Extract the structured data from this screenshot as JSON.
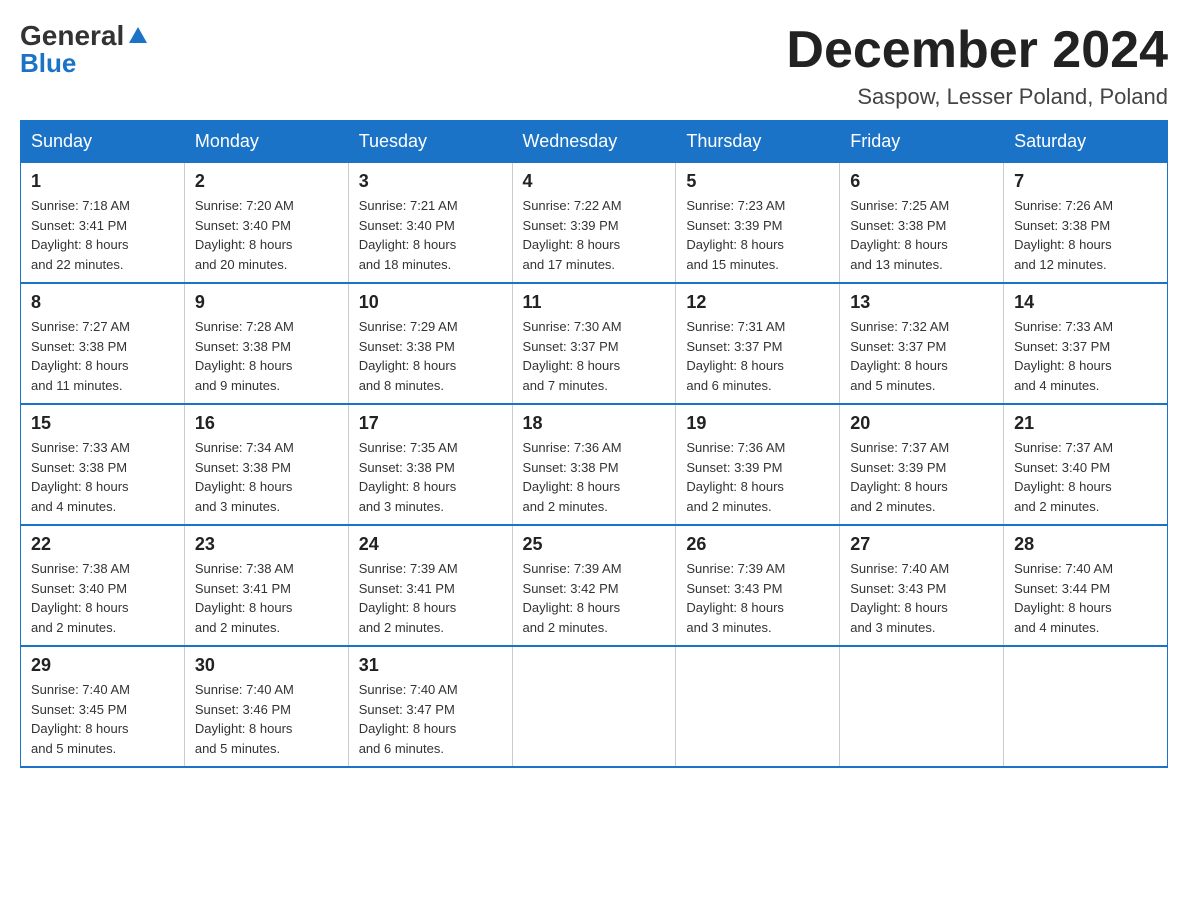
{
  "logo": {
    "general": "General",
    "blue": "Blue"
  },
  "title": "December 2024",
  "location": "Saspow, Lesser Poland, Poland",
  "days_of_week": [
    "Sunday",
    "Monday",
    "Tuesday",
    "Wednesday",
    "Thursday",
    "Friday",
    "Saturday"
  ],
  "weeks": [
    [
      {
        "day": "1",
        "sunrise": "7:18 AM",
        "sunset": "3:41 PM",
        "daylight": "8 hours and 22 minutes."
      },
      {
        "day": "2",
        "sunrise": "7:20 AM",
        "sunset": "3:40 PM",
        "daylight": "8 hours and 20 minutes."
      },
      {
        "day": "3",
        "sunrise": "7:21 AM",
        "sunset": "3:40 PM",
        "daylight": "8 hours and 18 minutes."
      },
      {
        "day": "4",
        "sunrise": "7:22 AM",
        "sunset": "3:39 PM",
        "daylight": "8 hours and 17 minutes."
      },
      {
        "day": "5",
        "sunrise": "7:23 AM",
        "sunset": "3:39 PM",
        "daylight": "8 hours and 15 minutes."
      },
      {
        "day": "6",
        "sunrise": "7:25 AM",
        "sunset": "3:38 PM",
        "daylight": "8 hours and 13 minutes."
      },
      {
        "day": "7",
        "sunrise": "7:26 AM",
        "sunset": "3:38 PM",
        "daylight": "8 hours and 12 minutes."
      }
    ],
    [
      {
        "day": "8",
        "sunrise": "7:27 AM",
        "sunset": "3:38 PM",
        "daylight": "8 hours and 11 minutes."
      },
      {
        "day": "9",
        "sunrise": "7:28 AM",
        "sunset": "3:38 PM",
        "daylight": "8 hours and 9 minutes."
      },
      {
        "day": "10",
        "sunrise": "7:29 AM",
        "sunset": "3:38 PM",
        "daylight": "8 hours and 8 minutes."
      },
      {
        "day": "11",
        "sunrise": "7:30 AM",
        "sunset": "3:37 PM",
        "daylight": "8 hours and 7 minutes."
      },
      {
        "day": "12",
        "sunrise": "7:31 AM",
        "sunset": "3:37 PM",
        "daylight": "8 hours and 6 minutes."
      },
      {
        "day": "13",
        "sunrise": "7:32 AM",
        "sunset": "3:37 PM",
        "daylight": "8 hours and 5 minutes."
      },
      {
        "day": "14",
        "sunrise": "7:33 AM",
        "sunset": "3:37 PM",
        "daylight": "8 hours and 4 minutes."
      }
    ],
    [
      {
        "day": "15",
        "sunrise": "7:33 AM",
        "sunset": "3:38 PM",
        "daylight": "8 hours and 4 minutes."
      },
      {
        "day": "16",
        "sunrise": "7:34 AM",
        "sunset": "3:38 PM",
        "daylight": "8 hours and 3 minutes."
      },
      {
        "day": "17",
        "sunrise": "7:35 AM",
        "sunset": "3:38 PM",
        "daylight": "8 hours and 3 minutes."
      },
      {
        "day": "18",
        "sunrise": "7:36 AM",
        "sunset": "3:38 PM",
        "daylight": "8 hours and 2 minutes."
      },
      {
        "day": "19",
        "sunrise": "7:36 AM",
        "sunset": "3:39 PM",
        "daylight": "8 hours and 2 minutes."
      },
      {
        "day": "20",
        "sunrise": "7:37 AM",
        "sunset": "3:39 PM",
        "daylight": "8 hours and 2 minutes."
      },
      {
        "day": "21",
        "sunrise": "7:37 AM",
        "sunset": "3:40 PM",
        "daylight": "8 hours and 2 minutes."
      }
    ],
    [
      {
        "day": "22",
        "sunrise": "7:38 AM",
        "sunset": "3:40 PM",
        "daylight": "8 hours and 2 minutes."
      },
      {
        "day": "23",
        "sunrise": "7:38 AM",
        "sunset": "3:41 PM",
        "daylight": "8 hours and 2 minutes."
      },
      {
        "day": "24",
        "sunrise": "7:39 AM",
        "sunset": "3:41 PM",
        "daylight": "8 hours and 2 minutes."
      },
      {
        "day": "25",
        "sunrise": "7:39 AM",
        "sunset": "3:42 PM",
        "daylight": "8 hours and 2 minutes."
      },
      {
        "day": "26",
        "sunrise": "7:39 AM",
        "sunset": "3:43 PM",
        "daylight": "8 hours and 3 minutes."
      },
      {
        "day": "27",
        "sunrise": "7:40 AM",
        "sunset": "3:43 PM",
        "daylight": "8 hours and 3 minutes."
      },
      {
        "day": "28",
        "sunrise": "7:40 AM",
        "sunset": "3:44 PM",
        "daylight": "8 hours and 4 minutes."
      }
    ],
    [
      {
        "day": "29",
        "sunrise": "7:40 AM",
        "sunset": "3:45 PM",
        "daylight": "8 hours and 5 minutes."
      },
      {
        "day": "30",
        "sunrise": "7:40 AM",
        "sunset": "3:46 PM",
        "daylight": "8 hours and 5 minutes."
      },
      {
        "day": "31",
        "sunrise": "7:40 AM",
        "sunset": "3:47 PM",
        "daylight": "8 hours and 6 minutes."
      },
      null,
      null,
      null,
      null
    ]
  ],
  "labels": {
    "sunrise": "Sunrise:",
    "sunset": "Sunset:",
    "daylight": "Daylight:"
  }
}
